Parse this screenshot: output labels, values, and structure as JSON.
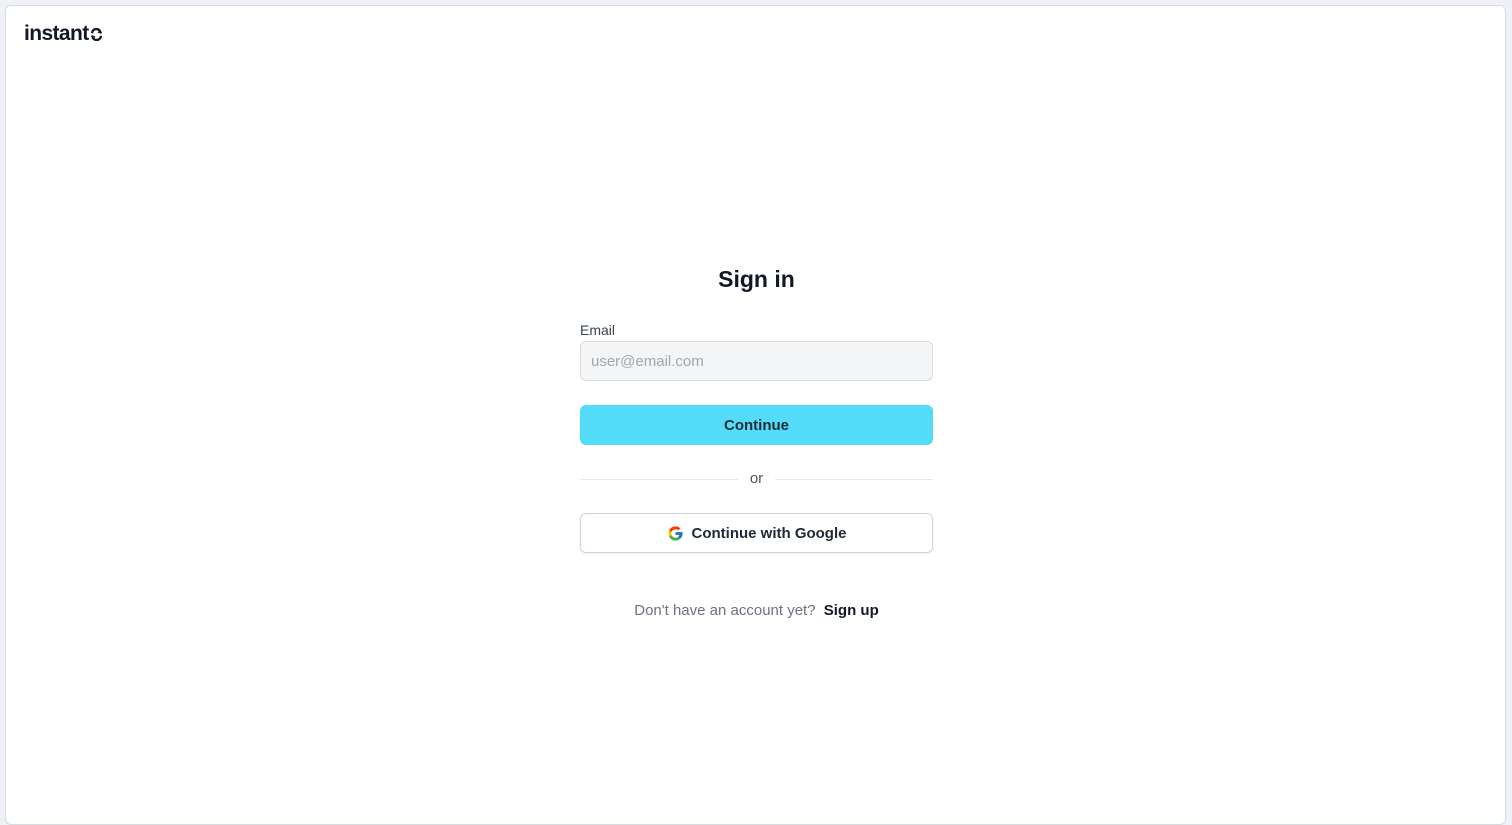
{
  "brand": {
    "logo_text": "instant",
    "logo_icon": "instant-mark-icon"
  },
  "signin": {
    "title": "Sign in",
    "email_label": "Email",
    "email_placeholder": "user@email.com",
    "email_value": "",
    "continue_label": "Continue",
    "divider_text": "or",
    "google_label": "Continue with Google",
    "google_icon": "google-icon",
    "signup_prompt": "Don't have an account yet?",
    "signup_link": "Sign up"
  },
  "colors": {
    "primary_button": "#53dcf8",
    "input_background": "#f3f5f7",
    "text_primary": "#111827",
    "text_muted": "#6b7280"
  }
}
